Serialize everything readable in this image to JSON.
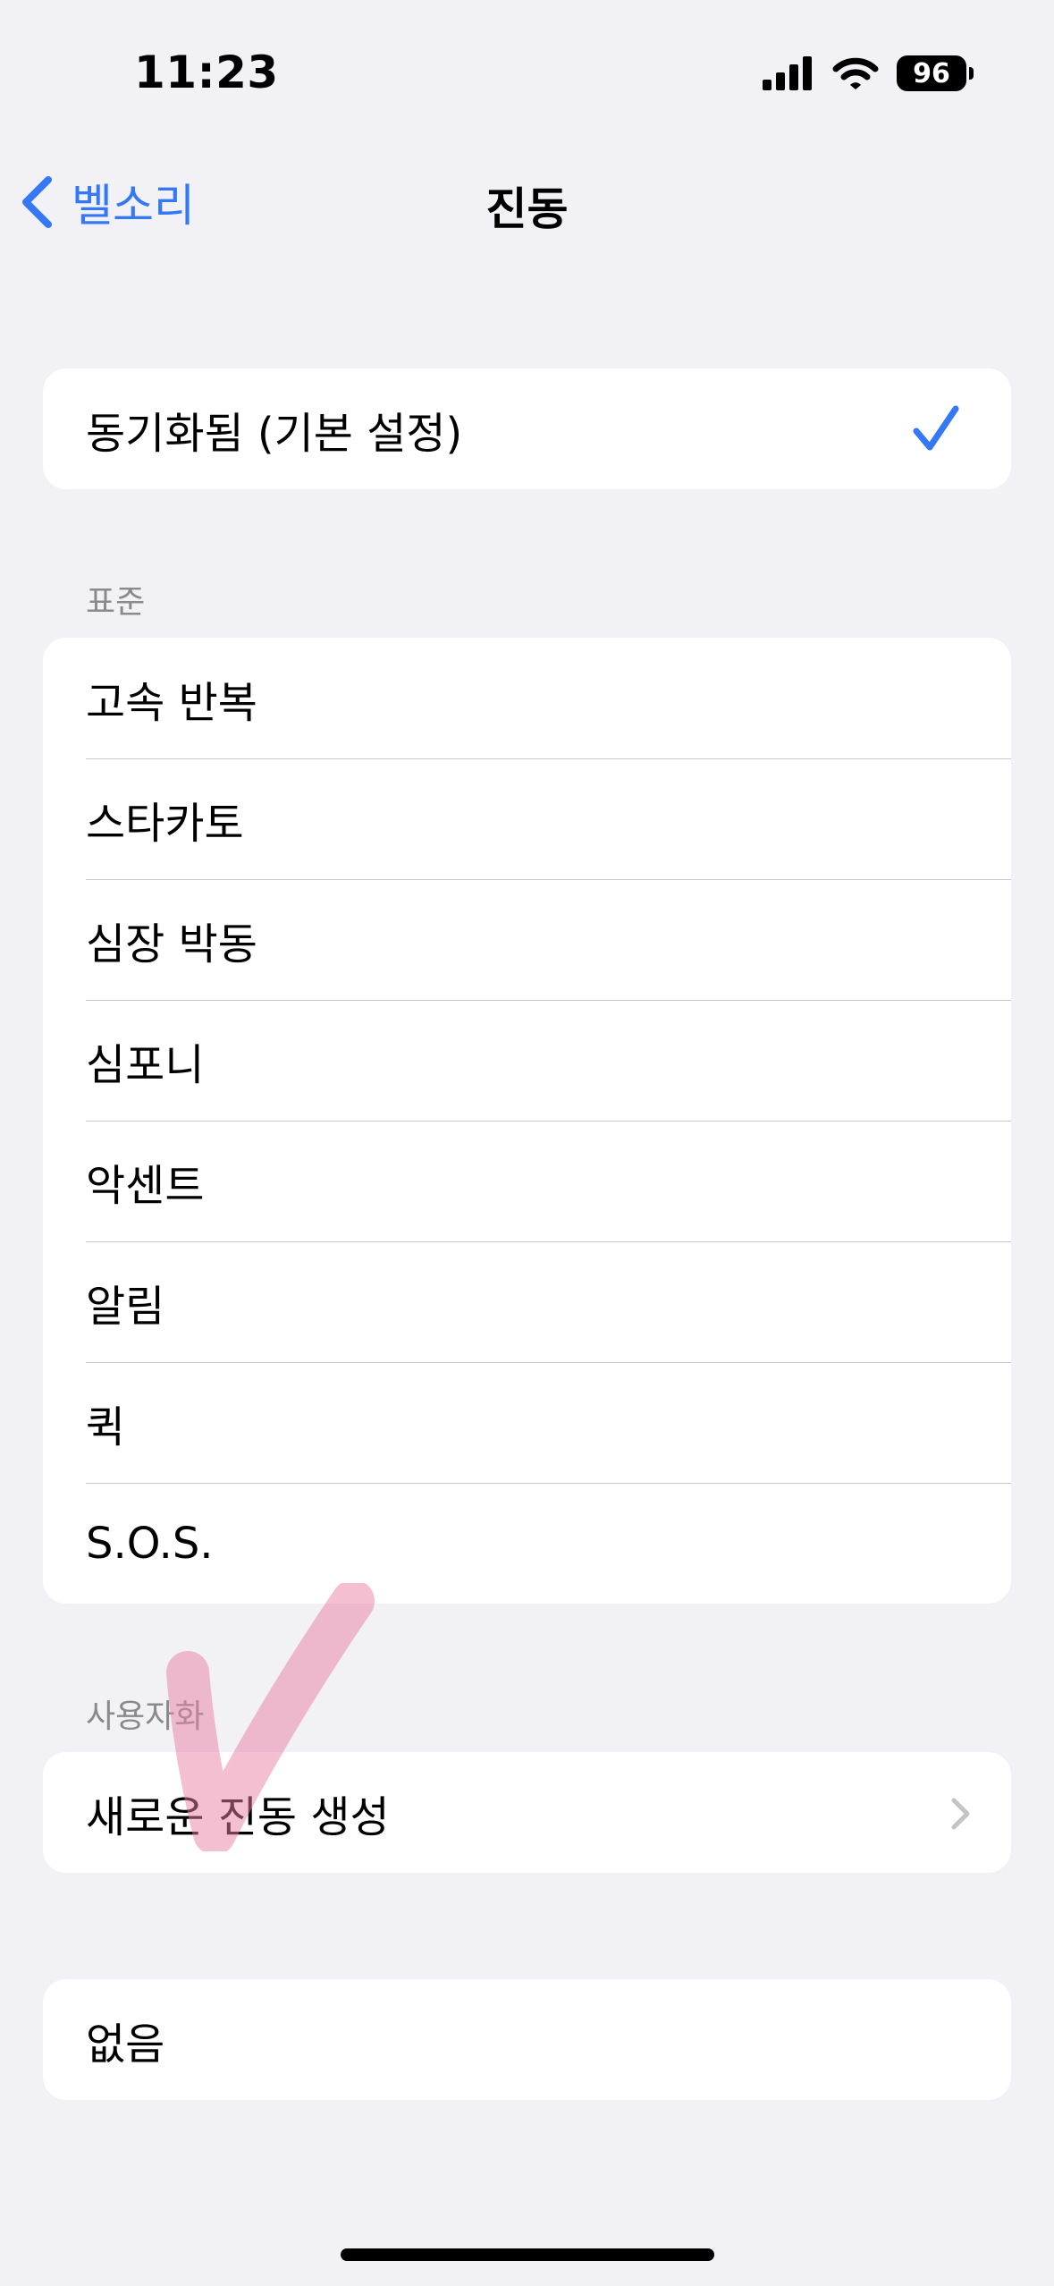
{
  "status_bar": {
    "time": "11:23",
    "battery": "96"
  },
  "nav": {
    "back_label": "벨소리",
    "title": "진동"
  },
  "synced_group": {
    "item": "동기화됨 (기본 설정)",
    "selected": true
  },
  "standard": {
    "header": "표준",
    "items": [
      "고속 반복",
      "스타카토",
      "심장 박동",
      "심포니",
      "악센트",
      "알림",
      "퀵",
      "S.O.S."
    ]
  },
  "custom": {
    "header": "사용자화",
    "create_label": "새로운 진동 생성"
  },
  "none": {
    "label": "없음"
  },
  "colors": {
    "accent": "#3478f6",
    "background": "#f2f1f6",
    "annotation": "#e77fa3"
  },
  "icons": [
    "chevron-left-icon",
    "checkmark-icon",
    "chevron-right-icon",
    "signal-icon",
    "wifi-icon",
    "battery-icon"
  ]
}
